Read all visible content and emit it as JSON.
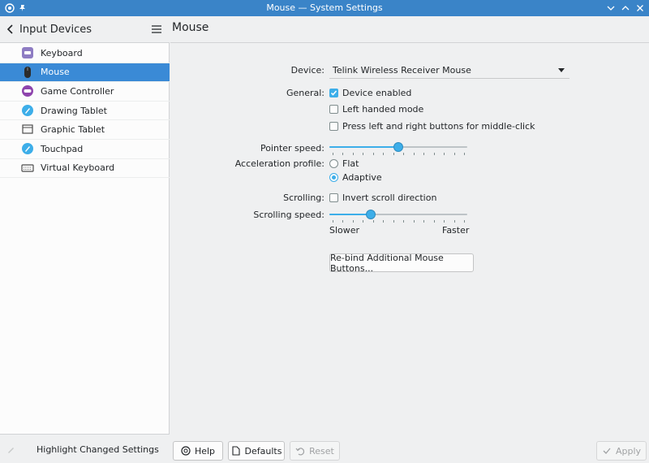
{
  "window": {
    "title": "Mouse — System Settings",
    "app_icon": "system-settings-icon",
    "pin_icon": "pin-icon",
    "controls": [
      "minimize-icon",
      "maximize-icon",
      "close-icon"
    ]
  },
  "sidebar": {
    "header_label": "Input Devices",
    "items": [
      {
        "label": "Keyboard",
        "icon": "keyboard-icon"
      },
      {
        "label": "Mouse",
        "icon": "mouse-icon",
        "active": true
      },
      {
        "label": "Game Controller",
        "icon": "game-controller-icon"
      },
      {
        "label": "Drawing Tablet",
        "icon": "drawing-tablet-icon"
      },
      {
        "label": "Graphic Tablet",
        "icon": "graphic-tablet-icon"
      },
      {
        "label": "Touchpad",
        "icon": "touchpad-icon"
      },
      {
        "label": "Virtual Keyboard",
        "icon": "virtual-keyboard-icon"
      }
    ],
    "footer_label": "Highlight Changed Settings"
  },
  "page": {
    "title": "Mouse",
    "device": {
      "label": "Device:",
      "value": "Telink Wireless Receiver Mouse"
    },
    "general": {
      "label": "General:",
      "options": [
        {
          "label": "Device enabled",
          "checked": true
        },
        {
          "label": "Left handed mode",
          "checked": false
        },
        {
          "label": "Press left and right buttons for middle-click",
          "checked": false
        }
      ]
    },
    "pointer_speed": {
      "label": "Pointer speed:",
      "value_fraction": 0.5
    },
    "acceleration": {
      "label": "Acceleration profile:",
      "options": [
        {
          "label": "Flat",
          "selected": false
        },
        {
          "label": "Adaptive",
          "selected": true
        }
      ]
    },
    "scrolling": {
      "label": "Scrolling:",
      "option": {
        "label": "Invert scroll direction",
        "checked": false
      }
    },
    "scrolling_speed": {
      "label": "Scrolling speed:",
      "value_fraction": 0.3,
      "min_label": "Slower",
      "max_label": "Faster"
    },
    "rebind_button": "Re-bind Additional Mouse Buttons..."
  },
  "footer": {
    "help": "Help",
    "defaults": "Defaults",
    "reset": "Reset",
    "apply": "Apply"
  },
  "colors": {
    "accent": "#3daee9",
    "titlebar": "#3a84c8",
    "selection": "#3a8ad6"
  }
}
